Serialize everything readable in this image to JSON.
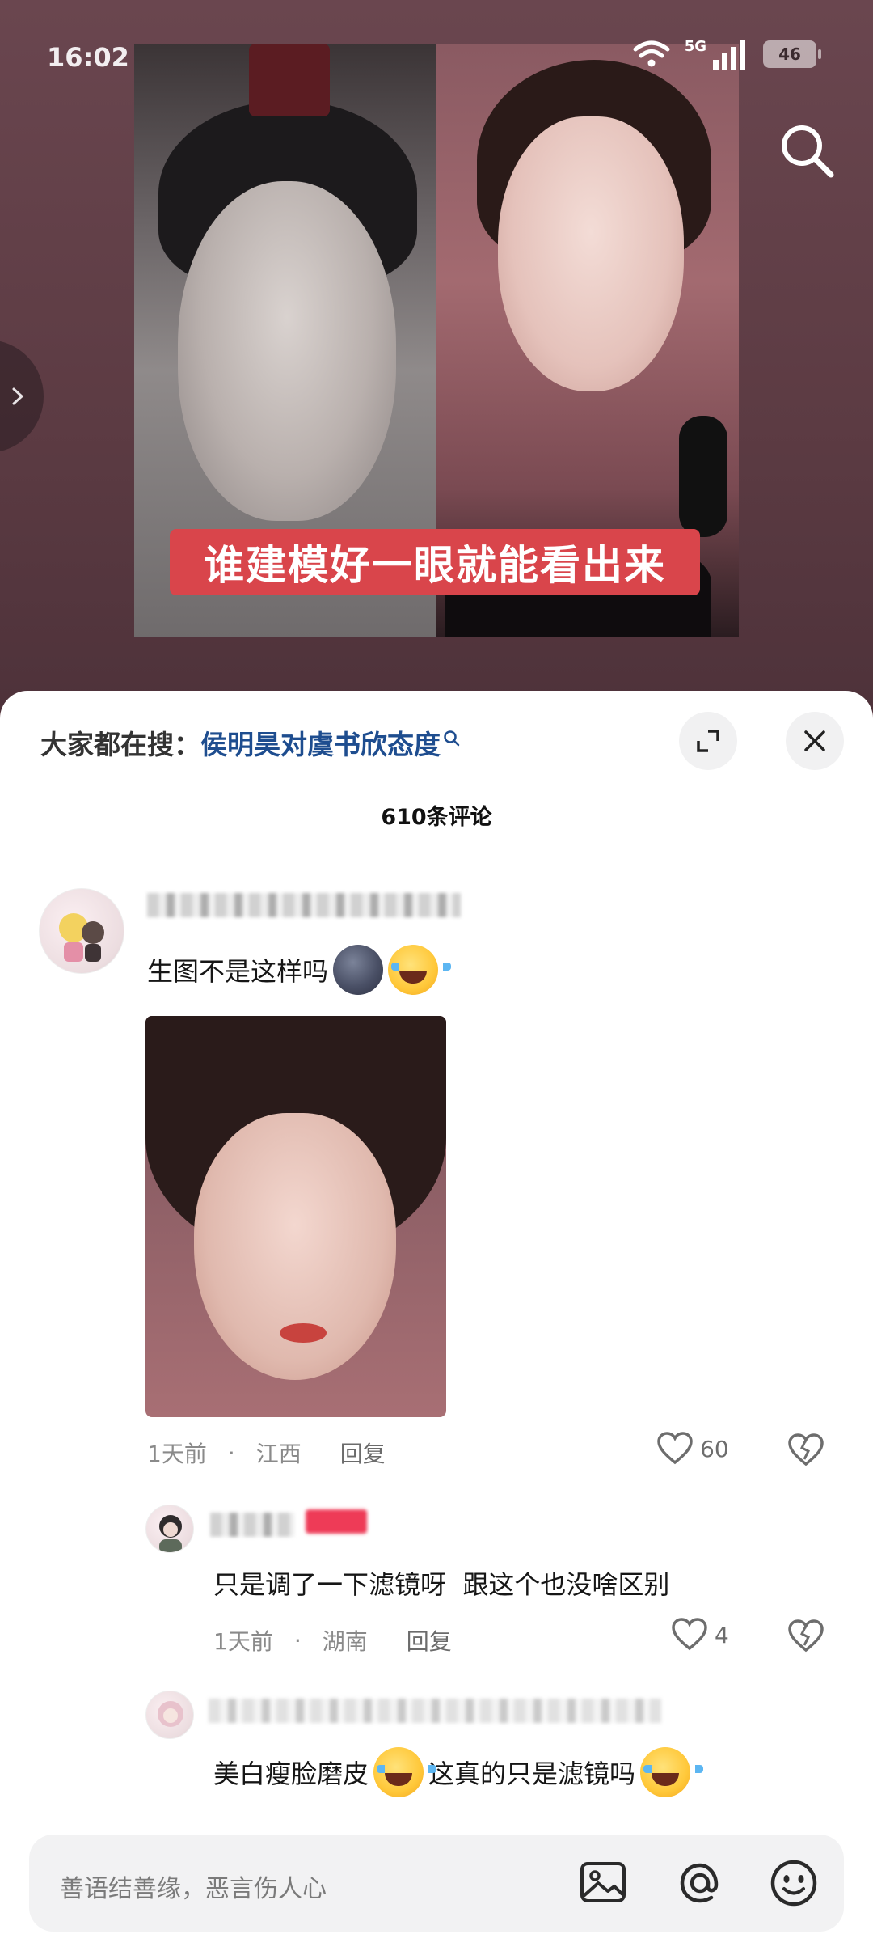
{
  "status_bar": {
    "time": "16:02",
    "network": "5G",
    "battery": "46"
  },
  "video": {
    "caption": "谁建模好一眼就能看出来"
  },
  "sheet": {
    "trending_lead": "大家都在搜：",
    "trending_query": "侯明昊对虞书欣态度",
    "comment_count": "610条评论"
  },
  "comments": [
    {
      "text": "生图不是这样吗",
      "time": "1天前",
      "location": "江西",
      "reply_label": "回复",
      "likes": "60"
    },
    {
      "text": "只是调了一下滤镜呀  跟这个也没啥区别",
      "time": "1天前",
      "location": "湖南",
      "reply_label": "回复",
      "likes": "4"
    },
    {
      "text_a": "美白瘦脸磨皮",
      "text_b": "这真的只是滤镜吗"
    }
  ],
  "input": {
    "placeholder": "善语结善缘，恶言伤人心"
  },
  "colors": {
    "accent_link": "#1e4d8f",
    "caption_bg": "#d9454b",
    "tag_red": "#ee3b57"
  }
}
